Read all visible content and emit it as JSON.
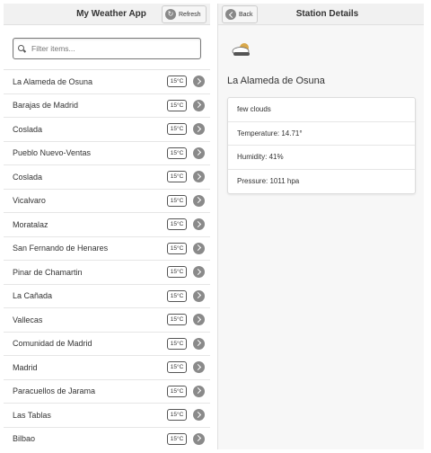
{
  "left_panel": {
    "title": "My Weather App",
    "refresh_label": "Refresh",
    "filter_placeholder": "Filter items...",
    "stations": [
      {
        "name": "La Alameda de Osuna",
        "temp": "15°C"
      },
      {
        "name": "Barajas de Madrid",
        "temp": "15°C"
      },
      {
        "name": "Coslada",
        "temp": "15°C"
      },
      {
        "name": "Pueblo Nuevo-Ventas",
        "temp": "15°C"
      },
      {
        "name": "Coslada",
        "temp": "15°C"
      },
      {
        "name": "Vicalvaro",
        "temp": "15°C"
      },
      {
        "name": "Moratalaz",
        "temp": "15°C"
      },
      {
        "name": "San Fernando de Henares",
        "temp": "15°C"
      },
      {
        "name": "Pinar de Chamartin",
        "temp": "15°C"
      },
      {
        "name": "La Cañada",
        "temp": "15°C"
      },
      {
        "name": "Vallecas",
        "temp": "15°C"
      },
      {
        "name": "Comunidad de Madrid",
        "temp": "15°C"
      },
      {
        "name": "Madrid",
        "temp": "15°C"
      },
      {
        "name": "Paracuellos de Jarama",
        "temp": "15°C"
      },
      {
        "name": "Las Tablas",
        "temp": "15°C"
      },
      {
        "name": "Bilbao",
        "temp": "15°C"
      }
    ]
  },
  "right_panel": {
    "back_label": "Back",
    "title": "Station Details",
    "weather_icon": "few-clouds-icon",
    "station_name": "La Alameda de Osuna",
    "details": [
      "few clouds",
      "Temperature: 14.71°",
      "Humidity: 41%",
      "Pressure: 1011 hpa"
    ]
  }
}
